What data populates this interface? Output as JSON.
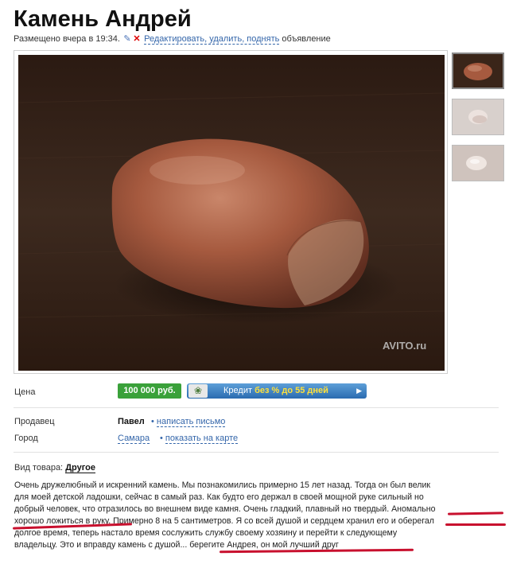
{
  "listing": {
    "title": "Камень Андрей",
    "posted": "Размещено вчера в 19:34.",
    "edit_links": "Редактировать, удалить, поднять",
    "edit_suffix": "объявление",
    "watermark": "AVITO.ru"
  },
  "icons": {
    "edit": "pencil-icon",
    "delete": "cross-icon",
    "credit_logo": "bank-seal-icon"
  },
  "colors": {
    "price_badge": "#3aa13a",
    "credit_banner": "#2a6bb0",
    "link": "#3466aa",
    "annotation": "#c8102e"
  },
  "details": {
    "price_label": "Цена",
    "price": "100 000 руб.",
    "credit_prefix": "Кредит",
    "credit_highlight": "без % до 55 дней",
    "seller_label": "Продавец",
    "seller_name": "Павел",
    "write_link": "написать письмо",
    "city_label": "Город",
    "city": "Самара",
    "map_link": "показать на карте",
    "category_label": "Вид товара:",
    "category": "Другое"
  },
  "description": {
    "lines": [
      "Очень дружелюбный и искренний камень. Мы познакомились примерно 15 лет назад. Тогда он был велик",
      "для моей детской ладошки, сейчас в самый раз. Как будто его держал в своей мощной руке сильный но",
      "добрый человек, что отразилось во внешнем виде камня. Очень гладкий, плавный но твердый. Аномально",
      "хорошо ложиться в руку. Примерно 8 на 5 сантиметров. Я со всей душой и сердцем хранил его и оберегал",
      "долгое время, теперь настало время сослужить службу своему хозяину и перейти к следующему",
      "владельцу. Это и вправду камень с душой... берегите Андрея, он мой лучший друг"
    ]
  }
}
